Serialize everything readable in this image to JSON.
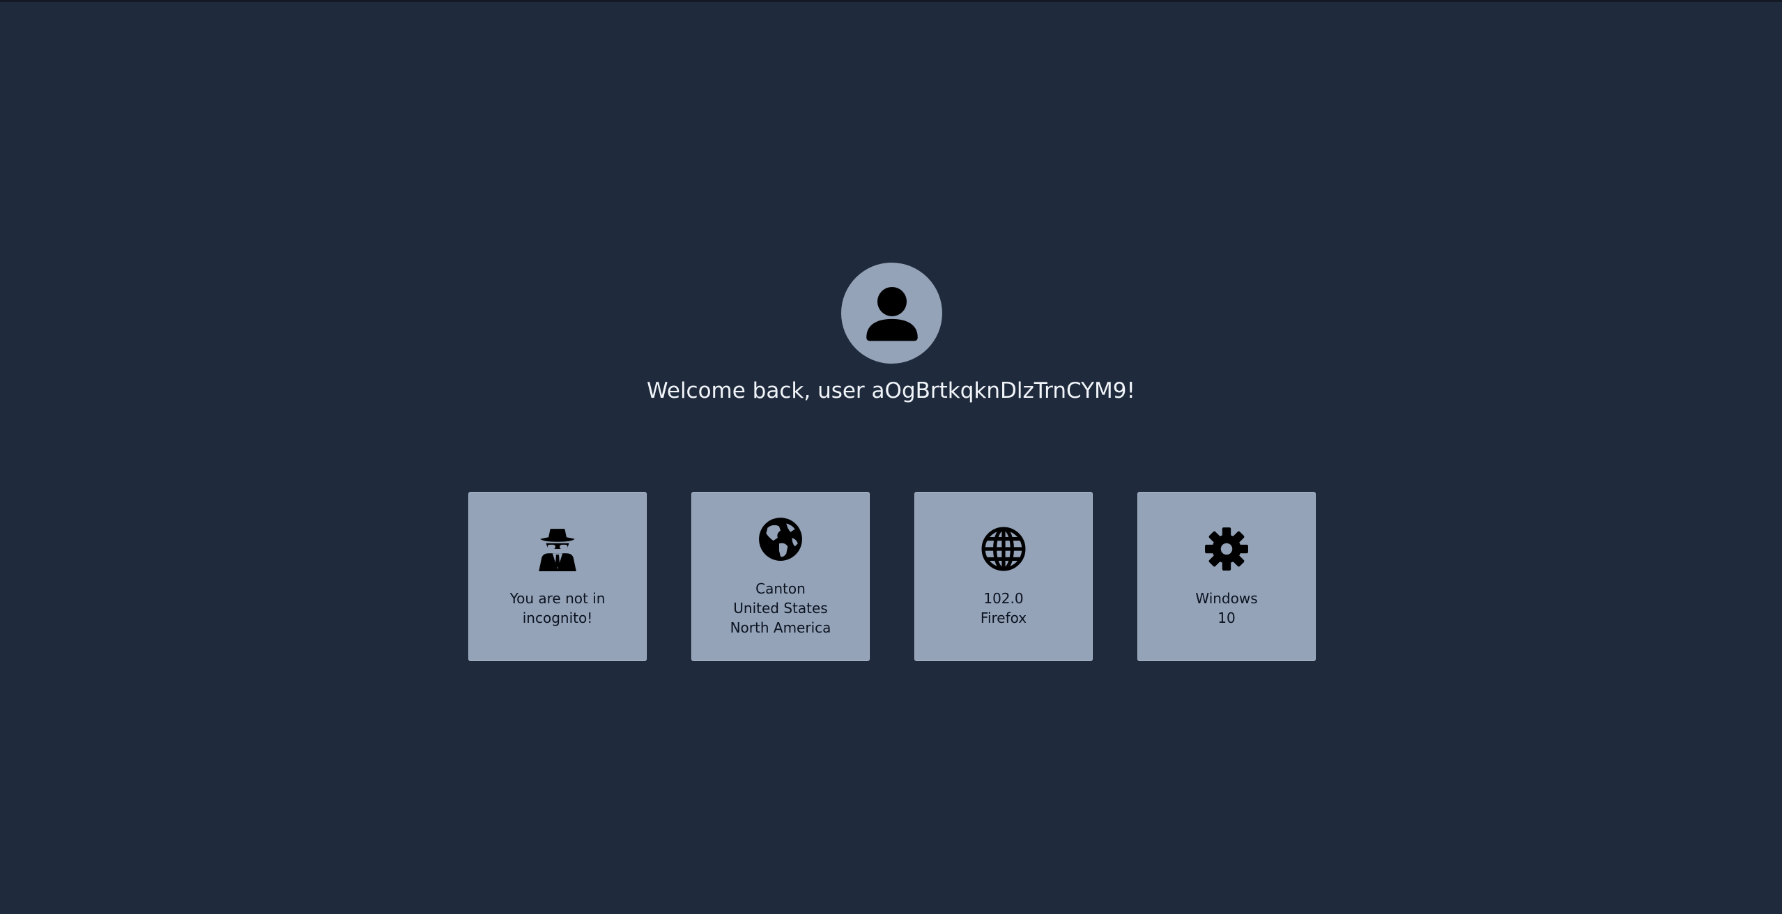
{
  "welcome": {
    "prefix": "Welcome back, user ",
    "username": "aOgBrtkqknDlzTrnCYM9",
    "suffix": "!"
  },
  "cards": {
    "incognito": {
      "icon": "incognito-spy-icon",
      "lines": [
        "You are not in",
        "incognito!"
      ]
    },
    "location": {
      "icon": "earth-globe-icon",
      "lines": [
        "Canton",
        "United States",
        "North America"
      ]
    },
    "browser": {
      "icon": "globe-grid-icon",
      "lines": [
        "102.0",
        "Firefox"
      ]
    },
    "os": {
      "icon": "gear-icon",
      "lines": [
        "Windows",
        "10"
      ]
    }
  },
  "colors": {
    "background": "#1f2a3c",
    "card": "#94a3b8",
    "icon": "#000000",
    "welcome_text": "#f1f5f9"
  }
}
